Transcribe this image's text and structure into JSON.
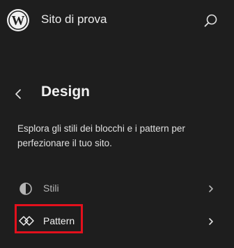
{
  "header": {
    "site_name": "Sito di prova",
    "logo_icon": "wordpress-logo-icon",
    "search_icon": "search-icon"
  },
  "panel": {
    "title": "Design",
    "back_icon": "chevron-left-icon",
    "description": "Esplora gli stili dei blocchi e i pattern per perfezionare il tuo sito."
  },
  "nav": {
    "items": [
      {
        "label": "Stili",
        "icon": "half-circle-icon"
      },
      {
        "label": "Pattern",
        "icon": "diamond-pattern-icon"
      }
    ]
  },
  "colors": {
    "background": "#1e1e1e",
    "text": "#e0e0e0",
    "muted_text": "#b5b5b5",
    "highlight": "#e3101c"
  }
}
